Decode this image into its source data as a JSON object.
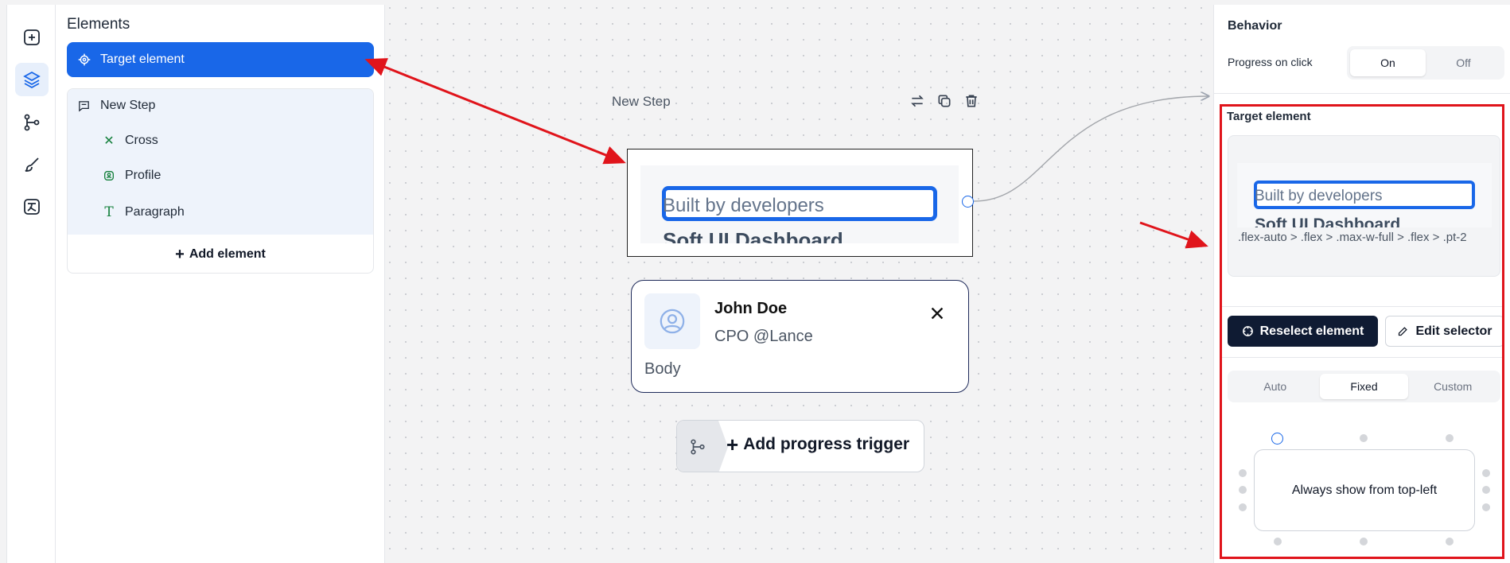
{
  "rail": {
    "icons": [
      "plus-square-icon",
      "layers-icon",
      "branch-icon",
      "brush-icon",
      "translate-icon"
    ],
    "active_index": 1
  },
  "elements_panel": {
    "title": "Elements",
    "selected_item": "Target element",
    "step": {
      "label": "New Step",
      "children": [
        {
          "label": "Cross",
          "icon": "x-icon"
        },
        {
          "label": "Profile",
          "icon": "profile-icon"
        },
        {
          "label": "Paragraph",
          "icon": "text-icon"
        }
      ]
    },
    "add_element_label": "Add element"
  },
  "canvas": {
    "node_title": "New Step",
    "preview": {
      "line1": "Built by developers",
      "line2": "Soft UI Dashboard"
    },
    "card": {
      "name": "John Doe",
      "role": "CPO @Lance",
      "body": "Body"
    },
    "trigger_label": "Add progress trigger"
  },
  "right_panel": {
    "behavior_heading": "Behavior",
    "progress_label": "Progress on click",
    "progress_options": [
      "On",
      "Off"
    ],
    "progress_selected": "On",
    "target_heading": "Target element",
    "preview": {
      "line1": "Built by developers",
      "line2": "Soft UI Dashboard"
    },
    "selector": ".flex-auto > .flex > .max-w-full > .flex > .pt-2",
    "reselect_label": "Reselect element",
    "edit_selector_label": "Edit selector",
    "position_modes": [
      "Auto",
      "Fixed",
      "Custom"
    ],
    "position_selected": "Fixed",
    "position_caption": "Always show from top-left"
  },
  "colors": {
    "accent": "#1967e8",
    "annotation_red": "#e0141b",
    "dark_button": "#0f1b33"
  }
}
